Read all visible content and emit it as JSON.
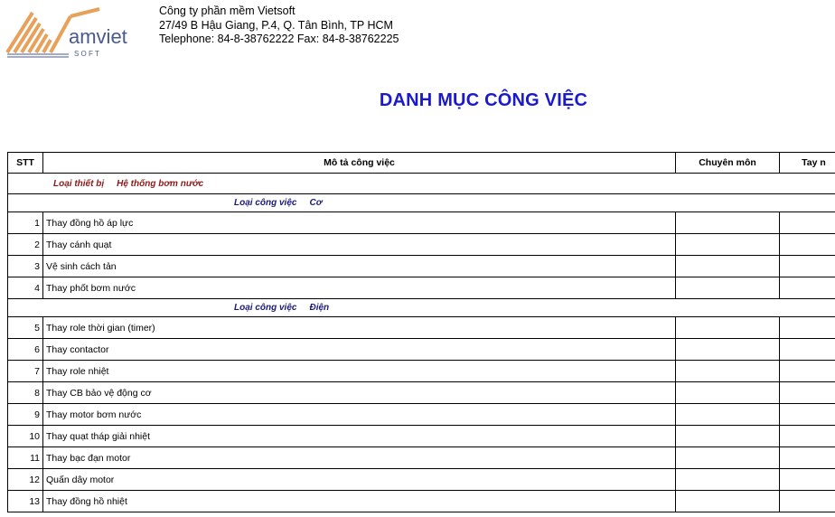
{
  "logo": {
    "wordmark": "amviet",
    "subtext": "S O F T"
  },
  "company": {
    "name": "Công ty phần mềm Vietsoft",
    "address": "27/49 B Hậu Giang, P.4, Q. Tân Bình, TP HCM",
    "contact": "Telephone: 84-8-38762222  Fax: 84-8-38762225"
  },
  "title": "DANH MỤC CÔNG VIỆC",
  "columns": {
    "stt": "STT",
    "desc": "Mô tả công việc",
    "skill": "Chuyên môn",
    "col4": "Tay n"
  },
  "group": {
    "label": "Loại thiết bị",
    "value": "Hệ thống bơm nước"
  },
  "sections": [
    {
      "label": "Loại công việc",
      "value": "Cơ",
      "rows": [
        {
          "stt": "1",
          "desc": "Thay đồng hồ áp lực"
        },
        {
          "stt": "2",
          "desc": "Thay cánh quạt"
        },
        {
          "stt": "3",
          "desc": "Vệ sinh cách tản"
        },
        {
          "stt": "4",
          "desc": "Thay phốt bơm nước"
        }
      ]
    },
    {
      "label": "Loại công việc",
      "value": "Điện",
      "rows": [
        {
          "stt": "5",
          "desc": "Thay role thời gian (timer)"
        },
        {
          "stt": "6",
          "desc": "Thay contactor"
        },
        {
          "stt": "7",
          "desc": "Thay role nhiệt"
        },
        {
          "stt": "8",
          "desc": "Thay CB bảo vệ động cơ"
        },
        {
          "stt": "9",
          "desc": "Thay motor bơm nước"
        },
        {
          "stt": "10",
          "desc": "Thay quạt tháp giải nhiệt"
        },
        {
          "stt": "11",
          "desc": "Thay bạc đạn motor"
        },
        {
          "stt": "12",
          "desc": "Quấn dây motor"
        },
        {
          "stt": "13",
          "desc": "Thay đồng hồ nhiệt"
        }
      ]
    }
  ],
  "colors": {
    "title": "#1a1acc",
    "group": "#8b1a1a",
    "section": "#1a1a7a",
    "logo": "#e8a15a"
  }
}
